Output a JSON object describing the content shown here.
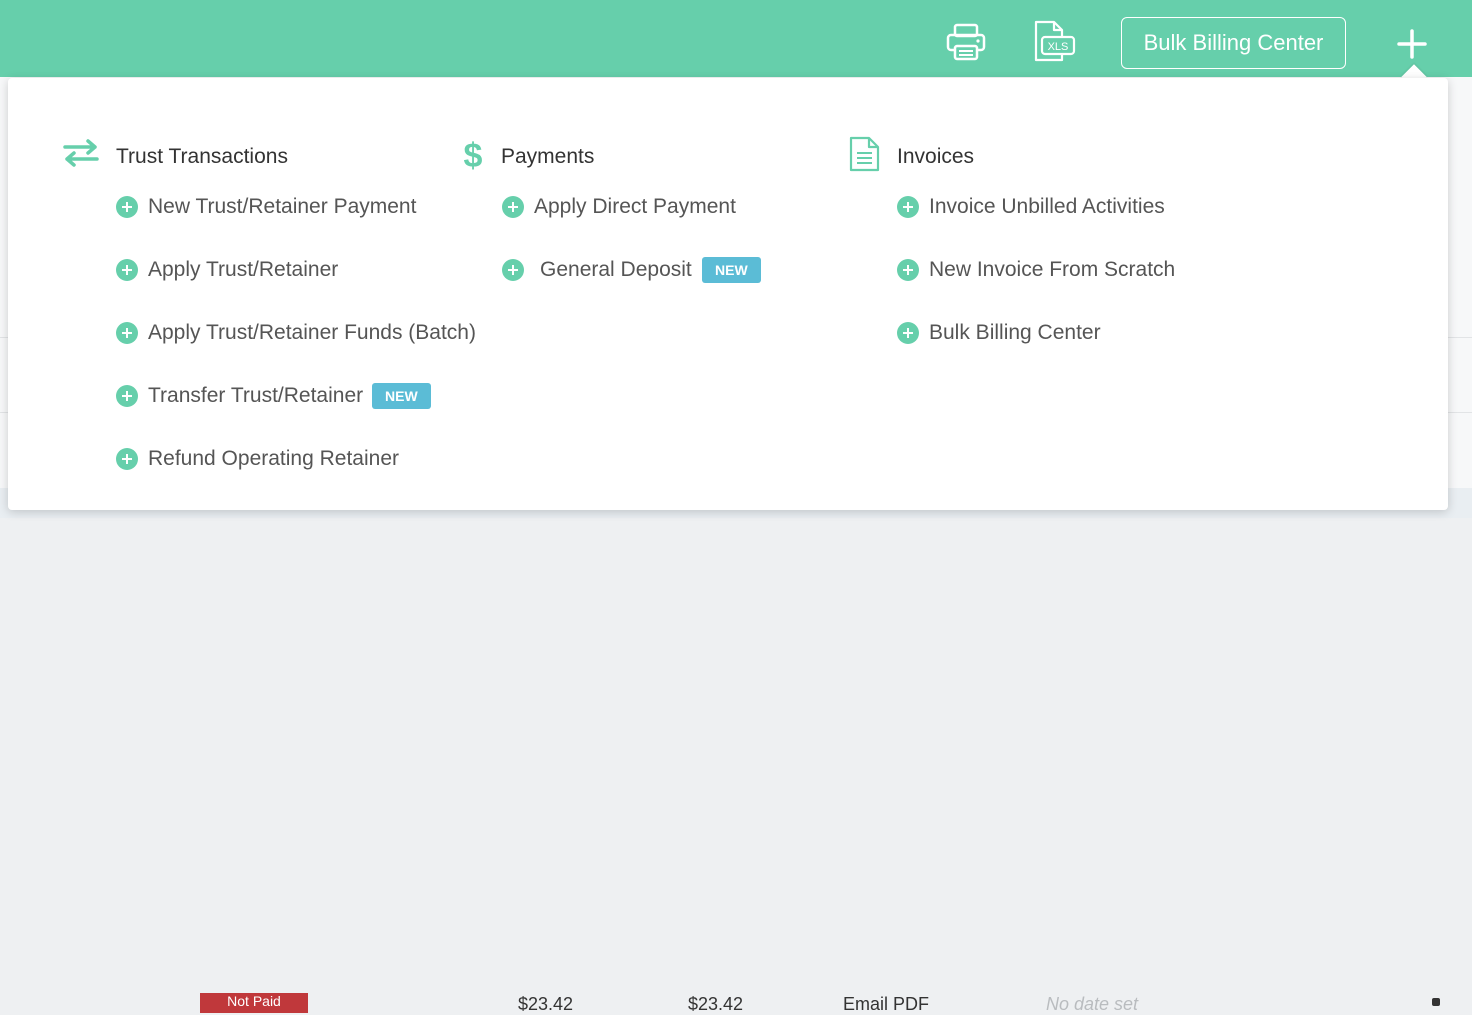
{
  "colors": {
    "brand": "#66cfab",
    "badge": "#5bbcd6",
    "not_paid": "#c0383b"
  },
  "header": {
    "print_icon": "printer-icon",
    "xls_icon": "xls-export-icon",
    "xls_text": "XLS",
    "bulk_billing_label": "Bulk Billing Center",
    "add_icon": "plus-icon"
  },
  "menu": {
    "trust": {
      "icon": "transfer-arrows-icon",
      "title": "Trust Transactions",
      "items": [
        {
          "label": "New Trust/Retainer Payment"
        },
        {
          "label": "Apply Trust/Retainer"
        },
        {
          "label": "Apply Trust/Retainer Funds (Batch)"
        },
        {
          "label": "Transfer Trust/Retainer",
          "badge": "NEW"
        },
        {
          "label": "Refund Operating Retainer"
        }
      ]
    },
    "payments": {
      "icon": "dollar-icon",
      "title": "Payments",
      "items": [
        {
          "label": "Apply Direct Payment"
        },
        {
          "label": "General Deposit",
          "badge": "NEW"
        }
      ]
    },
    "invoices": {
      "icon": "document-icon",
      "title": "Invoices",
      "items": [
        {
          "label": "Invoice Unbilled Activities"
        },
        {
          "label": "New Invoice From Scratch"
        },
        {
          "label": "Bulk Billing Center"
        }
      ]
    }
  },
  "background_row": {
    "status": "Not Paid",
    "amount_1": "$23.42",
    "amount_2": "$23.42",
    "delivery": "Email PDF",
    "date": "No date set"
  }
}
